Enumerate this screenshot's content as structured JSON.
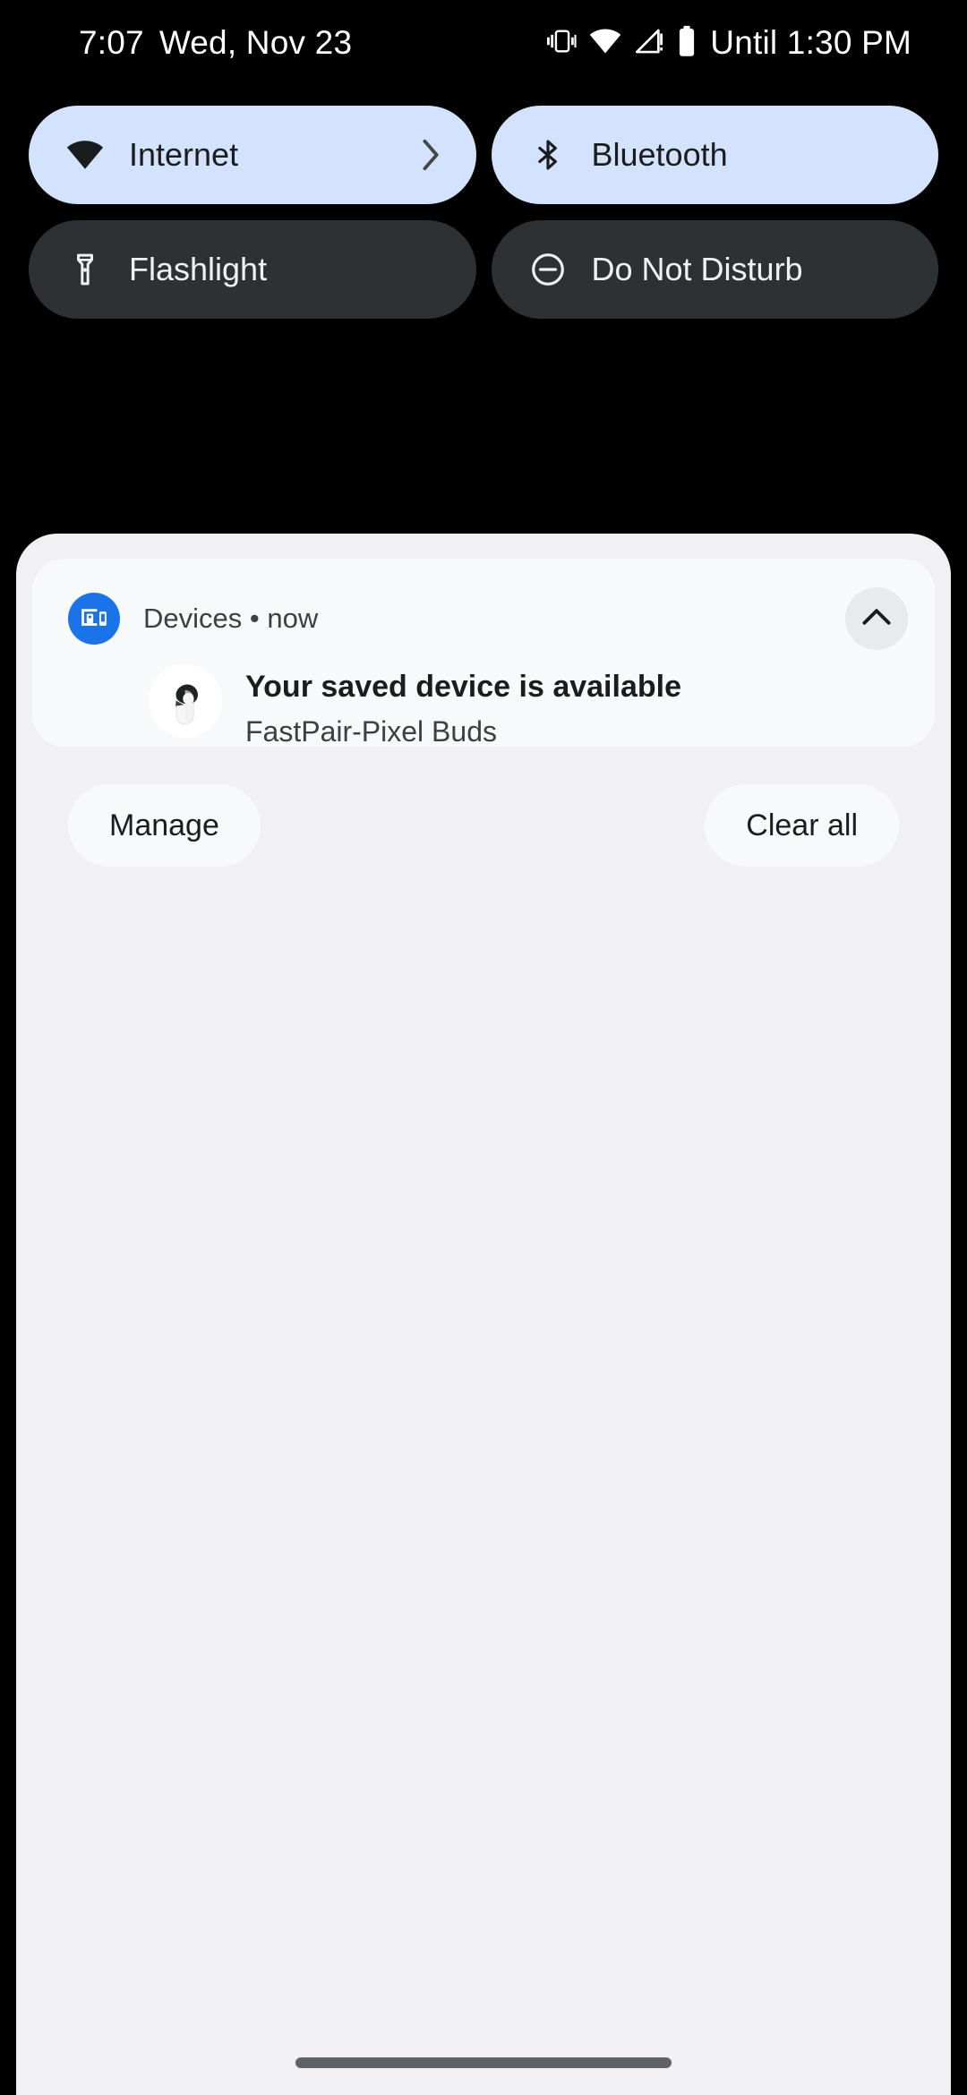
{
  "status_bar": {
    "time": "7:07",
    "date": "Wed, Nov 23",
    "battery_text": "Until 1:30 PM",
    "icons": [
      "vibrate-icon",
      "wifi-icon",
      "mobile-signal-no-service-icon",
      "battery-icon"
    ]
  },
  "quick_settings": {
    "tiles": [
      {
        "label": "Internet",
        "icon": "wifi-icon",
        "state": "active",
        "has_chevron": true
      },
      {
        "label": "Bluetooth",
        "icon": "bluetooth-icon",
        "state": "active",
        "has_chevron": false
      },
      {
        "label": "Flashlight",
        "icon": "flashlight-icon",
        "state": "inactive",
        "has_chevron": false
      },
      {
        "label": "Do Not Disturb",
        "icon": "do-not-disturb-icon",
        "state": "inactive",
        "has_chevron": false
      }
    ],
    "active_color": "#d3e3fd",
    "inactive_color": "#2e3133"
  },
  "notification": {
    "app_name": "Devices",
    "separator": "•",
    "time": "now",
    "meta": "Devices • now",
    "title": "Your saved device is available",
    "subtitle": "FastPair-Pixel Buds",
    "app_icon": "devices-icon",
    "app_icon_color": "#1a73e8",
    "thumbnail": "pixel-buds-earbud-image",
    "collapse_icon": "chevron-up-icon"
  },
  "shade_actions": {
    "manage_label": "Manage",
    "clear_all_label": "Clear all"
  },
  "navigation": {
    "handle": "gesture-nav-handle"
  }
}
